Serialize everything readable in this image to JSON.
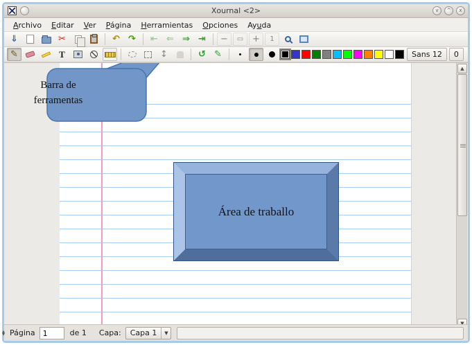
{
  "window": {
    "title": "Xournal <2>",
    "controls": {
      "shade": "v",
      "maximize": "^",
      "close": "x"
    }
  },
  "menu": {
    "items": [
      {
        "pre": "",
        "u": "A",
        "post": "rchivo"
      },
      {
        "pre": "",
        "u": "E",
        "post": "ditar"
      },
      {
        "pre": "",
        "u": "V",
        "post": "er"
      },
      {
        "pre": "",
        "u": "P",
        "post": "ágina"
      },
      {
        "pre": "",
        "u": "H",
        "post": "erramientas"
      },
      {
        "pre": "",
        "u": "O",
        "post": "pciones"
      },
      {
        "pre": "Ay",
        "u": "u",
        "post": "da"
      }
    ]
  },
  "toolbar_main": {
    "icons": [
      {
        "name": "save",
        "glyph": "⇓"
      },
      {
        "name": "new-page",
        "glyph": ""
      },
      {
        "name": "open",
        "glyph": ""
      },
      {
        "name": "cut",
        "glyph": "✂"
      },
      {
        "name": "copy",
        "glyph": ""
      },
      {
        "name": "paste",
        "glyph": ""
      },
      {
        "name": "undo",
        "glyph": "↶"
      },
      {
        "name": "redo",
        "glyph": "↷"
      },
      {
        "name": "first-page",
        "glyph": "⇤"
      },
      {
        "name": "previous-page",
        "glyph": "⇐"
      },
      {
        "name": "next-page",
        "glyph": "⇒"
      },
      {
        "name": "last-page",
        "glyph": "⇥"
      },
      {
        "name": "zoom-out",
        "glyph": "−"
      },
      {
        "name": "zoom-fit-width",
        "glyph": "▭"
      },
      {
        "name": "zoom-in",
        "glyph": "+"
      },
      {
        "name": "zoom-100",
        "glyph": "1"
      },
      {
        "name": "set-zoom",
        "glyph": ""
      },
      {
        "name": "fullscreen",
        "glyph": ""
      }
    ]
  },
  "toolbar_tools": {
    "icons": [
      {
        "name": "pen",
        "glyph": "✎"
      },
      {
        "name": "eraser",
        "glyph": ""
      },
      {
        "name": "highlighter",
        "glyph": ""
      },
      {
        "name": "text",
        "glyph": "T"
      },
      {
        "name": "image",
        "glyph": ""
      },
      {
        "name": "shape-recognizer",
        "glyph": ""
      },
      {
        "name": "ruler",
        "glyph": ""
      },
      {
        "name": "select-region",
        "glyph": ""
      },
      {
        "name": "select-rectangle",
        "glyph": ""
      },
      {
        "name": "vertical-space",
        "glyph": "↕"
      },
      {
        "name": "hand-tool",
        "glyph": ""
      },
      {
        "name": "default-tool",
        "glyph": "↺"
      },
      {
        "name": "set-default",
        "glyph": "✎"
      }
    ],
    "pen_sizes": [
      "fine",
      "medium",
      "thick"
    ],
    "palette": [
      "#000000",
      "#3535cc",
      "#ff0000",
      "#008000",
      "#808080",
      "#00c0ff",
      "#00ff00",
      "#ff00ff",
      "#ff8000",
      "#ffff00",
      "#ffffff",
      "#000000"
    ],
    "font_button": "Sans 12",
    "extra_button": "0"
  },
  "canvas": {
    "callout_text": "Barra de ferramentas",
    "workarea_text": "Área de traballo",
    "colors": {
      "callout_fill": "#7296c8",
      "callout_border": "#4577ae",
      "rule_line": "#a9cdef",
      "margin_line": "#f09ac9",
      "workbox_face": "#7297ca"
    }
  },
  "statusbar": {
    "page_label": "Página",
    "page_value": "1",
    "of_label": "de 1",
    "layer_label": "Capa:",
    "layer_value": "Capa 1"
  }
}
